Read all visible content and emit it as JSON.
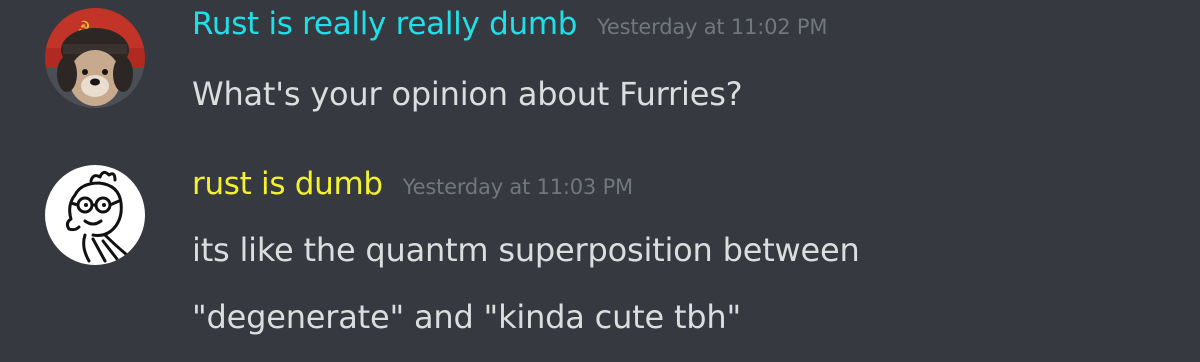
{
  "messages": [
    {
      "username": "Rust is really really dumb",
      "username_color": "#1ee0e8",
      "timestamp": "Yesterday at 11:02 PM",
      "lines": [
        "What's your opinion about Furries?"
      ],
      "avatar": "dog-in-ushanka-avatar"
    },
    {
      "username": "rust is dumb",
      "username_color": "#f2f22e",
      "timestamp": "Yesterday at 11:03 PM",
      "lines": [
        "its like the quantm superposition between",
        "\"degenerate\" and \"kinda cute tbh\""
      ],
      "avatar": "cartoon-sketch-avatar"
    }
  ]
}
